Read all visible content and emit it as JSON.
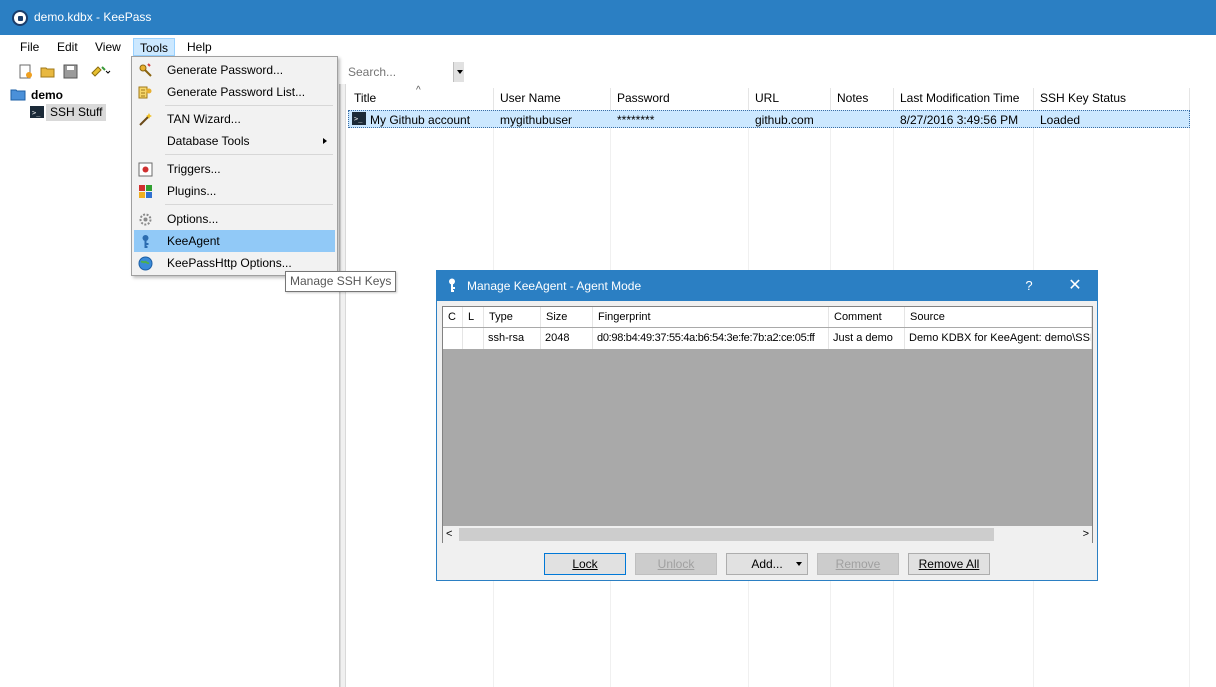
{
  "window": {
    "title": "demo.kdbx - KeePass"
  },
  "menubar": {
    "items": [
      "File",
      "Edit",
      "View",
      "Tools",
      "Help"
    ]
  },
  "search": {
    "placeholder": "Search..."
  },
  "tree": {
    "root": "demo",
    "child": "SSH Stuff"
  },
  "entries": {
    "columns": [
      "Title",
      "User Name",
      "Password",
      "URL",
      "Notes",
      "Last Modification Time",
      "SSH Key Status"
    ],
    "rows": [
      {
        "title": "My Github account",
        "username": "mygithubuser",
        "password": "********",
        "url": "github.com",
        "notes": "",
        "modified": "8/27/2016 3:49:56 PM",
        "ssh_status": "Loaded"
      }
    ]
  },
  "tools_menu": {
    "items": [
      {
        "label": "Generate Password...",
        "icon": "key-wand-icon"
      },
      {
        "label": "Generate Password List...",
        "icon": "key-list-icon"
      },
      {
        "label": "TAN Wizard...",
        "icon": "wand-icon"
      },
      {
        "label": "Database Tools",
        "icon": "",
        "submenu": true
      },
      {
        "label": "Triggers...",
        "icon": "triggers-icon"
      },
      {
        "label": "Plugins...",
        "icon": "plugins-icon"
      },
      {
        "label": "Options...",
        "icon": "gear-icon"
      },
      {
        "label": "KeeAgent",
        "icon": "keeagent-icon"
      },
      {
        "label": "KeePassHttp Options...",
        "icon": "globe-icon"
      }
    ]
  },
  "tooltip": {
    "text": "Manage SSH Keys"
  },
  "dialog": {
    "title": "Manage KeeAgent - Agent Mode",
    "help": "?",
    "close": "✕",
    "columns": [
      "C",
      "L",
      "Type",
      "Size",
      "Fingerprint",
      "Comment",
      "Source"
    ],
    "keys": [
      {
        "c": "",
        "l": "",
        "type": "ssh-rsa",
        "size": "2048",
        "fingerprint": "d0:98:b4:49:37:55:4a:b6:54:3e:fe:7b:a2:ce:05:ff",
        "comment": "Just a demo",
        "source": "Demo KDBX for KeeAgent: demo\\SSH"
      }
    ],
    "buttons": {
      "lock": "Lock",
      "unlock": "Unlock",
      "add": "Add...",
      "remove": "Remove",
      "remove_all": "Remove All"
    }
  },
  "colors": {
    "accent": "#2b7fc3",
    "selection": "#cce8ff",
    "menu_highlight": "#91c9f7"
  }
}
